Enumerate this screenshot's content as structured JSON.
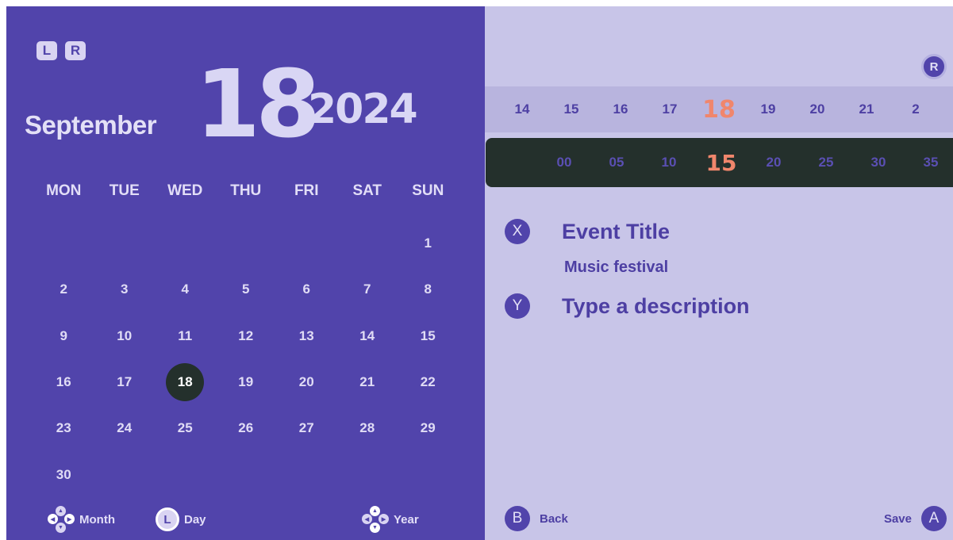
{
  "shoulder_buttons": [
    "L",
    "R"
  ],
  "header": {
    "month": "September",
    "day": "18",
    "year": "2024"
  },
  "weekdays": [
    "MON",
    "TUE",
    "WED",
    "THU",
    "FRI",
    "SAT",
    "SUN"
  ],
  "calendar": {
    "blank_before": 6,
    "days": [
      "1",
      "2",
      "3",
      "4",
      "5",
      "6",
      "7",
      "8",
      "9",
      "10",
      "11",
      "12",
      "13",
      "14",
      "15",
      "16",
      "17",
      "18",
      "19",
      "20",
      "21",
      "22",
      "23",
      "24",
      "25",
      "26",
      "27",
      "28",
      "29",
      "30"
    ],
    "selected": "18"
  },
  "hints": {
    "month_label": "Month",
    "day_button": "L",
    "day_label": "Day",
    "year_label": "Year"
  },
  "right": {
    "r_button": "R",
    "day_picker": [
      "14",
      "15",
      "16",
      "17",
      "18",
      "19",
      "20",
      "21",
      "2"
    ],
    "day_selected_index": 4,
    "minute_picker": [
      "00",
      "05",
      "10",
      "15",
      "20",
      "25",
      "30",
      "35"
    ],
    "minute_selected_index": 3,
    "title_button": "X",
    "title_label": "Event Title",
    "title_value": "Music festival",
    "desc_button": "Y",
    "desc_placeholder": "Type a description",
    "back_button": "B",
    "back_label": "Back",
    "save_label": "Save",
    "save_button": "A"
  }
}
